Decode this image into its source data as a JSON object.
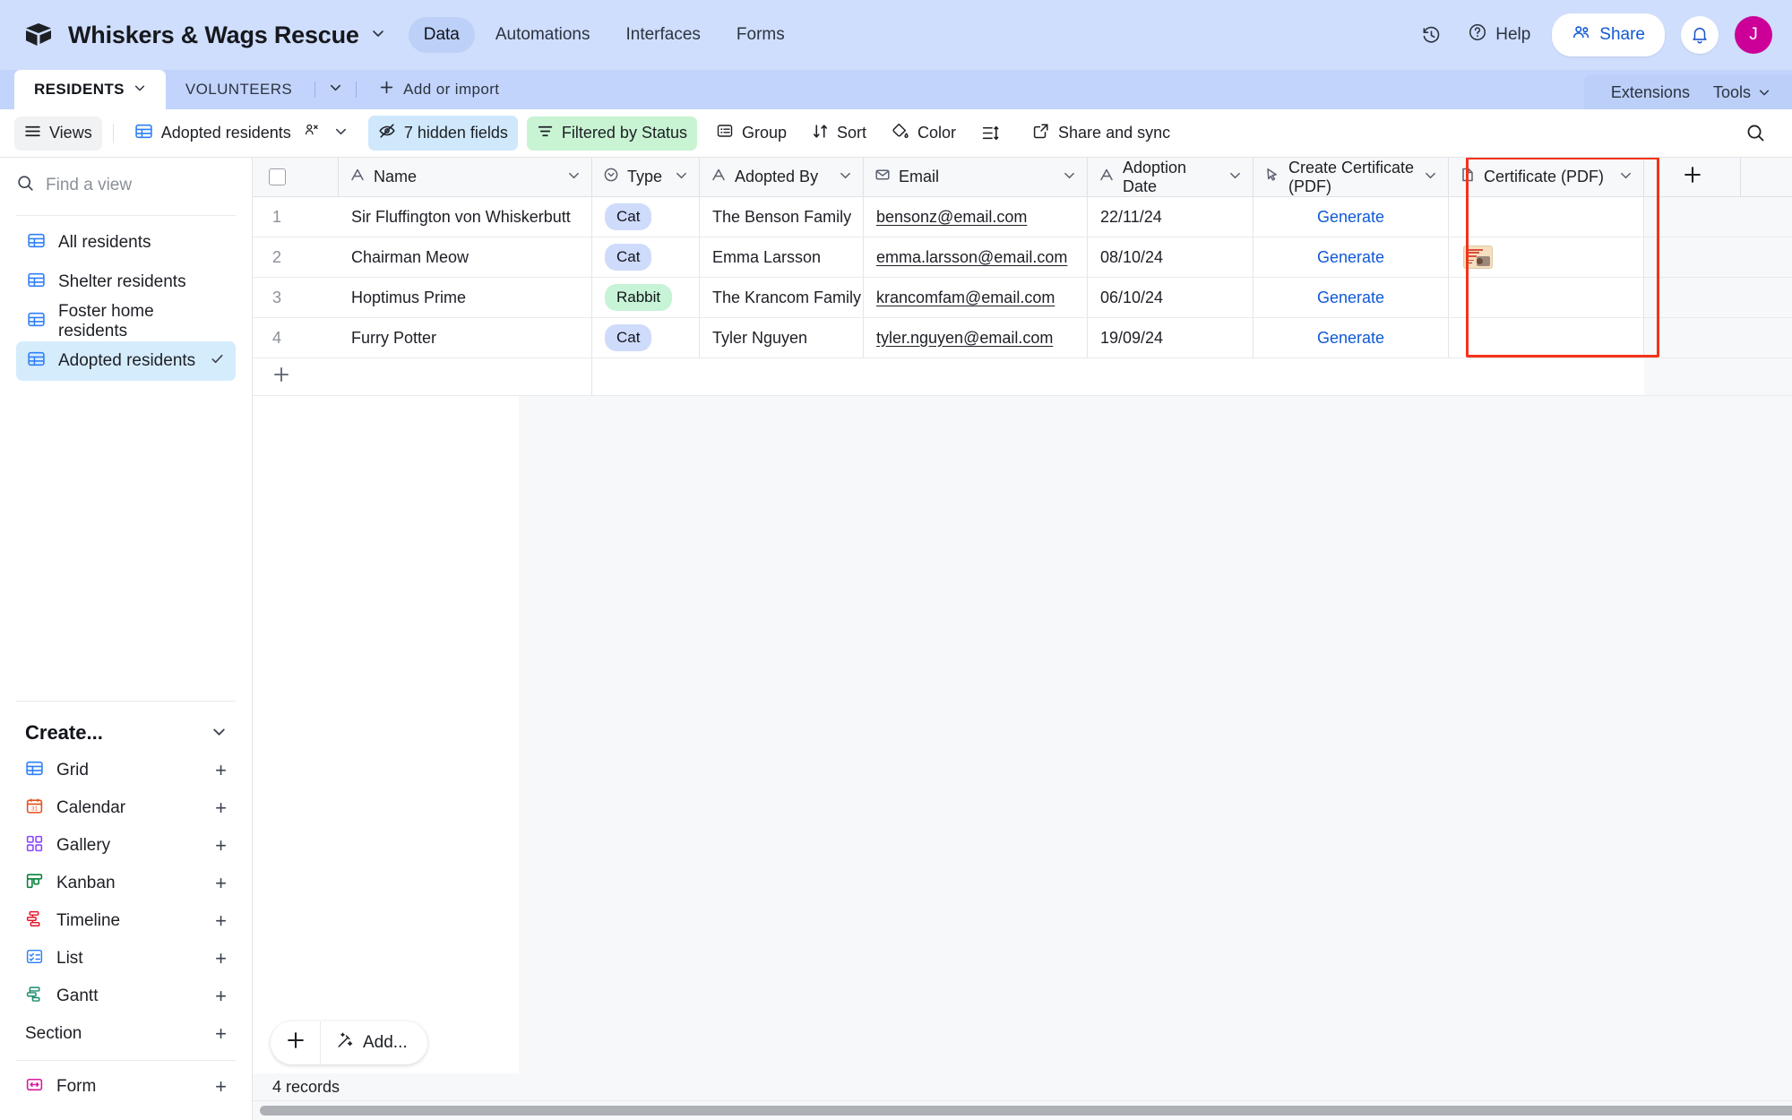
{
  "header": {
    "logo_icon": "airtable-cube-icon",
    "base_title": "Whiskers & Wags Rescue",
    "title_chevron": "chevron-down-icon",
    "nav": [
      {
        "label": "Data",
        "active": true
      },
      {
        "label": "Automations",
        "active": false
      },
      {
        "label": "Interfaces",
        "active": false
      },
      {
        "label": "Forms",
        "active": false
      }
    ],
    "history_icon": "history-clock-icon",
    "help_label": "Help",
    "help_icon": "question-circle-icon",
    "share_label": "Share",
    "share_icon": "people-icon",
    "notifications_icon": "bell-icon",
    "avatar_initial": "J",
    "avatar_color": "#cc0099"
  },
  "tabs": {
    "items": [
      {
        "label": "RESIDENTS",
        "active": true,
        "chevron": "chevron-down-icon"
      },
      {
        "label": "VOLUNTEERS",
        "active": false
      }
    ],
    "tabs_dropdown_icon": "chevron-down-icon",
    "add_label": "Add or import",
    "add_icon": "plus-icon",
    "right": [
      {
        "label": "Extensions"
      },
      {
        "label": "Tools",
        "chevron": "chevron-down-icon"
      }
    ]
  },
  "toolbar": {
    "views_label": "Views",
    "views_icon": "hamburger-icon",
    "current_view": "Adopted residents",
    "current_view_icon": "grid-icon",
    "collaborators_icon": "collaborators-icon",
    "view_chevron": "chevron-down-icon",
    "hidden_fields_label": "7 hidden fields",
    "hidden_fields_icon": "eye-off-icon",
    "filter_label": "Filtered by Status",
    "filter_icon": "filter-icon",
    "group_label": "Group",
    "group_icon": "group-icon",
    "sort_label": "Sort",
    "sort_icon": "sort-icon",
    "color_label": "Color",
    "color_icon": "paint-bucket-icon",
    "rowheight_icon": "row-height-icon",
    "share_sync_label": "Share and sync",
    "share_sync_icon": "external-link-icon",
    "search_icon": "search-icon"
  },
  "sidebar": {
    "search_placeholder": "Find a view",
    "search_value": "",
    "search_icon": "search-icon",
    "settings_icon": "gear-icon",
    "views": [
      {
        "label": "All residents",
        "icon": "grid-icon",
        "color": "#2d7ff9",
        "selected": false
      },
      {
        "label": "Shelter residents",
        "icon": "grid-icon",
        "color": "#2d7ff9",
        "selected": false
      },
      {
        "label": "Foster home residents",
        "icon": "grid-icon",
        "color": "#2d7ff9",
        "selected": false
      },
      {
        "label": "Adopted residents",
        "icon": "grid-icon",
        "color": "#2d7ff9",
        "selected": true,
        "check": "check-icon"
      }
    ],
    "create_header": "Create...",
    "create_chevron": "chevron-down-icon",
    "create_items": [
      {
        "label": "Grid",
        "icon": "grid-icon",
        "color": "#2d7ff9"
      },
      {
        "label": "Calendar",
        "icon": "calendar-icon",
        "color": "#e8501a"
      },
      {
        "label": "Gallery",
        "icon": "gallery-icon",
        "color": "#8b46ff"
      },
      {
        "label": "Kanban",
        "icon": "kanban-icon",
        "color": "#07823c"
      },
      {
        "label": "Timeline",
        "icon": "timeline-icon",
        "color": "#e3162b"
      },
      {
        "label": "List",
        "icon": "list-icon",
        "color": "#2d7ff9"
      },
      {
        "label": "Gantt",
        "icon": "gantt-icon",
        "color": "#1a8b6d"
      },
      {
        "label": "Section",
        "icon": "",
        "color": ""
      }
    ],
    "form_item": {
      "label": "Form",
      "icon": "form-icon",
      "color": "#d919a0"
    },
    "add_icon": "plus-icon"
  },
  "grid": {
    "select_all_icon": "checkbox-icon",
    "columns": [
      {
        "label": "Name",
        "icon": "text-field-icon",
        "chevron": "chevron-down-icon"
      },
      {
        "label": "Type",
        "icon": "single-select-icon",
        "chevron": "chevron-down-icon"
      },
      {
        "label": "Adopted By",
        "icon": "text-field-icon",
        "chevron": "chevron-down-icon"
      },
      {
        "label": "Email",
        "icon": "email-field-icon",
        "chevron": "chevron-down-icon"
      },
      {
        "label": "Adoption Date",
        "icon": "text-field-icon",
        "chevron": "chevron-down-icon"
      },
      {
        "label": "Create Certificate (PDF)",
        "icon": "button-field-icon",
        "chevron": "chevron-down-icon"
      },
      {
        "label": "Certificate (PDF)",
        "icon": "attachment-file-icon",
        "chevron": "chevron-down-icon"
      }
    ],
    "add_column_icon": "plus-icon",
    "rows": [
      {
        "num": "1",
        "name": "Sir Fluffington von Whiskerbutt",
        "type": "Cat",
        "type_color": "cat",
        "adopted_by": "The Benson Family",
        "email": "bensonz@email.com",
        "date": "22/11/24",
        "action": "Generate",
        "certificate": ""
      },
      {
        "num": "2",
        "name": "Chairman Meow",
        "type": "Cat",
        "type_color": "cat",
        "adopted_by": "Emma Larsson",
        "email": "emma.larsson@email.com",
        "date": "08/10/24",
        "action": "Generate",
        "certificate": "certificate-thumbnail"
      },
      {
        "num": "3",
        "name": "Hoptimus Prime",
        "type": "Rabbit",
        "type_color": "rabbit",
        "adopted_by": "The Krancom Family",
        "email": "krancomfam@email.com",
        "date": "06/10/24",
        "action": "Generate",
        "certificate": ""
      },
      {
        "num": "4",
        "name": "Furry Potter",
        "type": "Cat",
        "type_color": "cat",
        "adopted_by": "Tyler Nguyen",
        "email": "tyler.nguyen@email.com",
        "date": "19/09/24",
        "action": "Generate",
        "certificate": ""
      }
    ],
    "add_row_icon": "plus-icon"
  },
  "footer": {
    "add_record_icon": "plus-icon",
    "add_ai_label": "Add...",
    "add_ai_icon": "magic-wand-icon",
    "record_count": "4 records"
  },
  "annotation": {
    "highlight_color": "#f4331b",
    "target": "Certificate (PDF)"
  }
}
